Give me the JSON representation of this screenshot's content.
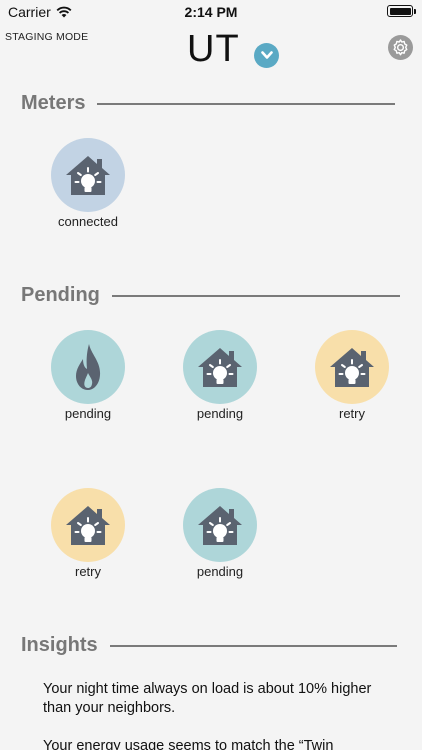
{
  "status_bar": {
    "carrier": "Carrier",
    "time": "2:14 PM"
  },
  "header": {
    "mode_label": "STAGING MODE",
    "title": "UT"
  },
  "sections": {
    "meters": "Meters",
    "pending": "Pending",
    "insights": "Insights"
  },
  "meters": [
    {
      "icon": "house-bulb-icon",
      "status": "connected",
      "color": "#c2d3e4"
    }
  ],
  "pending": [
    {
      "icon": "flame-icon",
      "status": "pending",
      "color": "#aed6d9"
    },
    {
      "icon": "house-bulb-icon",
      "status": "pending",
      "color": "#aed6d9"
    },
    {
      "icon": "house-bulb-icon",
      "status": "retry",
      "color": "#f8dfaa"
    },
    {
      "icon": "house-bulb-icon",
      "status": "retry",
      "color": "#f8dfaa"
    },
    {
      "icon": "house-bulb-icon",
      "status": "pending",
      "color": "#aed6d9"
    }
  ],
  "insights": [
    "Your night time always on load is about 10% higher than your neighbors.",
    "Your energy usage seems to match the “Twin"
  ]
}
